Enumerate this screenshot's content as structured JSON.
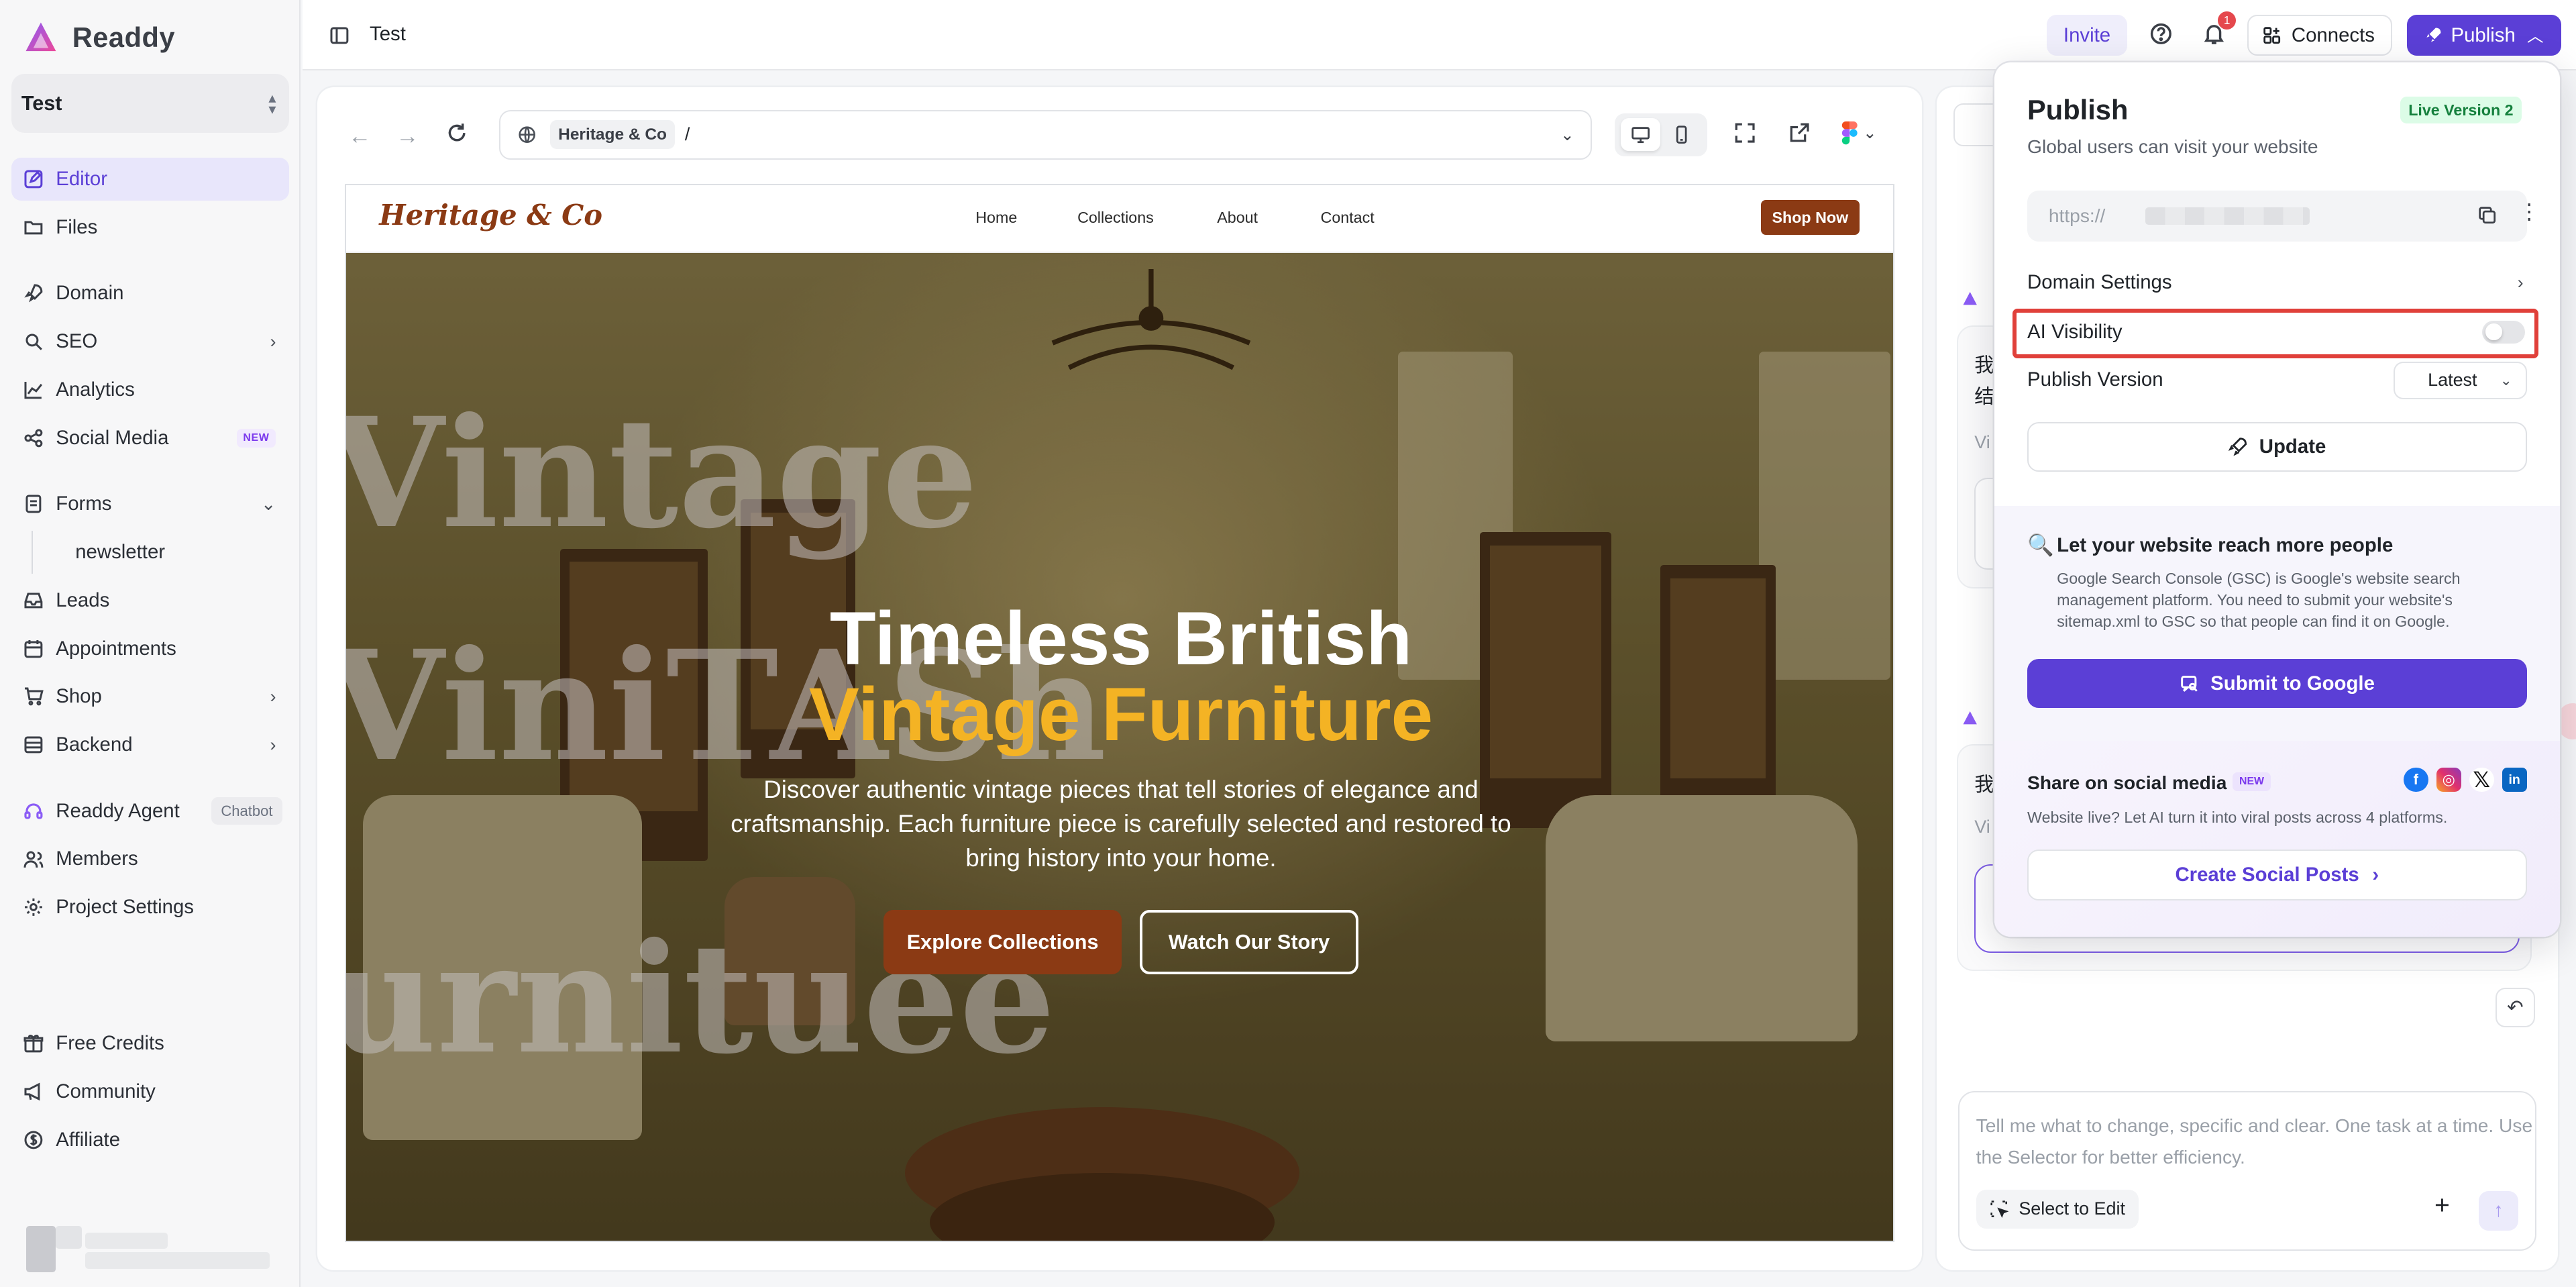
{
  "brand": {
    "name": "Readdy",
    "accent": "#5b3fd6"
  },
  "project": {
    "name": "Test"
  },
  "sidebar": {
    "items": [
      {
        "label": "Editor",
        "icon": "edit-icon",
        "active": true
      },
      {
        "label": "Files",
        "icon": "folder-icon"
      },
      {
        "label": "Domain",
        "icon": "rocket-icon"
      },
      {
        "label": "SEO",
        "icon": "search-icon"
      },
      {
        "label": "Analytics",
        "icon": "chart-icon"
      },
      {
        "label": "Social Media",
        "icon": "share-icon",
        "badge": "NEW"
      },
      {
        "label": "Forms",
        "icon": "form-icon"
      },
      {
        "label": "newsletter"
      },
      {
        "label": "Leads",
        "icon": "inbox-icon"
      },
      {
        "label": "Appointments",
        "icon": "calendar-icon"
      },
      {
        "label": "Shop",
        "icon": "cart-icon"
      },
      {
        "label": "Backend",
        "icon": "database-icon"
      },
      {
        "label": "Readdy Agent",
        "icon": "headset-icon",
        "badge": "Chatbot"
      },
      {
        "label": "Members",
        "icon": "users-icon"
      },
      {
        "label": "Project Settings",
        "icon": "gear-icon"
      }
    ],
    "bottom": [
      {
        "label": "Free Credits",
        "icon": "gift-icon"
      },
      {
        "label": "Community",
        "icon": "megaphone-icon"
      },
      {
        "label": "Affiliate",
        "icon": "dollar-icon"
      }
    ]
  },
  "topbar": {
    "title": "Test",
    "invite": "Invite",
    "notifications": "1",
    "connects": "Connects",
    "publish": "Publish"
  },
  "editor": {
    "url_chip": "Heritage & Co",
    "url_path": "/"
  },
  "site": {
    "logo": "Heritage & Co",
    "nav": [
      "Home",
      "Collections",
      "About",
      "Contact"
    ],
    "shop_now": "Shop Now",
    "ghost_1": "Vintage",
    "ghost_2": "ViniTASh",
    "ghost_3": "urnituee",
    "hero_title_1": "Timeless British",
    "hero_title_2": "Vintage Furniture",
    "hero_sub": "Discover authentic vintage pieces that tell stories of elegance and craftsmanship. Each furniture piece is carefully selected and restored to bring history into your home.",
    "btn_primary": "Explore Collections",
    "btn_secondary": "Watch Our Story"
  },
  "chat": {
    "msg1_line1": "我",
    "msg1_line2": "结",
    "msg1_muted": "Vi",
    "msg2_line1": "我",
    "msg2_muted": "Vi",
    "placeholder": "Tell me what to change, specific and clear. One task at a time. Use the Selector for better efficiency.",
    "select_to_edit": "Select to Edit"
  },
  "publish": {
    "title": "Publish",
    "live_badge": "Live Version 2",
    "subtitle": "Global users can visit your website",
    "url_prefix": "https://",
    "domain_settings": "Domain Settings",
    "ai_visibility": "AI Visibility",
    "ai_visibility_on": false,
    "publish_version": "Publish Version",
    "version_value": "Latest",
    "update": "Update",
    "gsc_title": "Let your website reach more people",
    "gsc_desc": "Google Search Console (GSC) is Google's website search management platform. You need to submit your website's sitemap.xml to GSC so that people can find it on Google.",
    "gsc_button": "Submit to Google",
    "social_title": "Share on social media",
    "social_badge": "NEW",
    "social_desc": "Website live? Let AI turn it into viral posts across 4 platforms.",
    "social_button": "Create Social Posts",
    "social_icons": [
      "facebook-icon",
      "instagram-icon",
      "x-icon",
      "linkedin-icon"
    ]
  }
}
